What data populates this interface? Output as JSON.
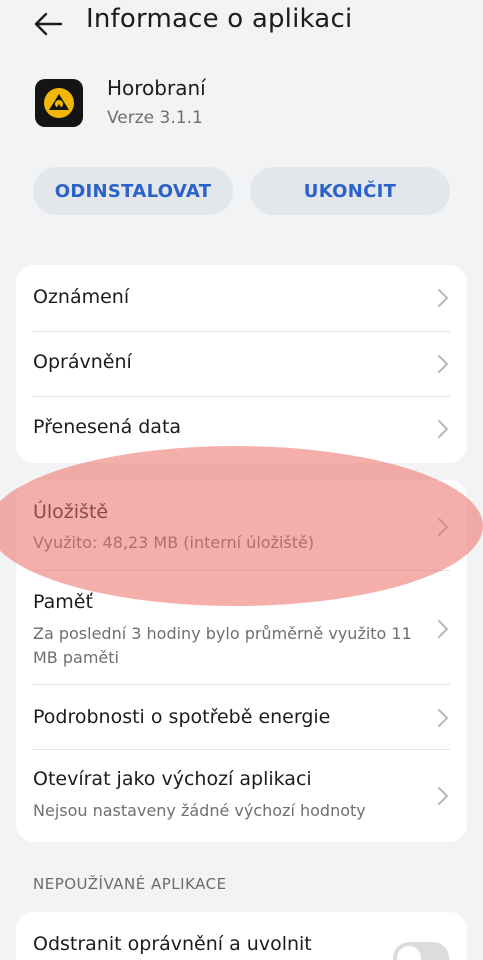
{
  "header": {
    "title": "Informace o aplikaci"
  },
  "app": {
    "name": "Horobraní",
    "version": "Verze 3.1.1"
  },
  "actions": {
    "uninstall": "ODINSTALOVAT",
    "stop": "UKONČIT"
  },
  "group1": [
    {
      "title": "Oznámení"
    },
    {
      "title": "Oprávnění"
    },
    {
      "title": "Přenesená data"
    }
  ],
  "group2": {
    "storage": {
      "title": "Úložiště",
      "sub": "Využito: 48,23 MB (interní úložiště)"
    },
    "memory": {
      "title": "Paměť",
      "sub": "Za poslední 3 hodiny bylo průměrně využito 11 MB paměti"
    },
    "energy": {
      "title": "Podrobnosti o spotřebě energie"
    },
    "default_app": {
      "title": "Otevírat jako výchozí aplikaci",
      "sub": "Nejsou nastaveny žádné výchozí hodnoty"
    }
  },
  "unused_section": {
    "label": "NEPOUŽÍVANÉ APLIKACE",
    "item": {
      "title": "Odstranit oprávnění a uvolnit",
      "toggle_on": false
    }
  },
  "colors": {
    "accent": "#2a62c9",
    "background": "#f1f3f5",
    "card": "#ffffff",
    "highlight": "#ec6e64",
    "app_icon_fg": "#f2b705"
  }
}
